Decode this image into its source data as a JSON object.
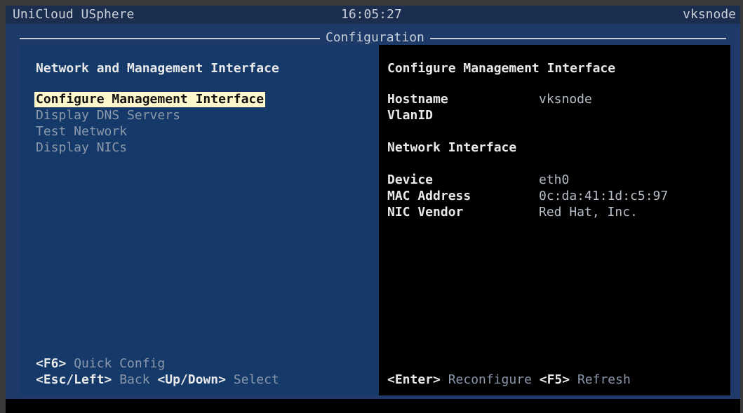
{
  "header": {
    "brand": "UniCloud USphere",
    "time": "16:05:27",
    "hostname": "vksnode"
  },
  "frame_title": "Configuration",
  "left_panel": {
    "heading": "Network and Management Interface",
    "menu": [
      {
        "label": "Configure Management Interface",
        "selected": true
      },
      {
        "label": "Display DNS Servers",
        "selected": false
      },
      {
        "label": "Test Network",
        "selected": false
      },
      {
        "label": "Display NICs",
        "selected": false
      }
    ],
    "footer": {
      "line1": {
        "key": "<F6>",
        "text": " Quick Config"
      },
      "line2": [
        {
          "key": "<Esc/Left>",
          "text": " Back "
        },
        {
          "key": "<Up/Down>",
          "text": " Select"
        }
      ]
    }
  },
  "right_panel": {
    "heading": "Configure Management Interface",
    "fields": [
      {
        "label": "Hostname",
        "value": "vksnode"
      },
      {
        "label": "VlanID",
        "value": ""
      }
    ],
    "section2_heading": "Network Interface",
    "nic_fields": [
      {
        "label": "Device",
        "value": "eth0"
      },
      {
        "label": "MAC Address",
        "value": "0c:da:41:1d:c5:97"
      },
      {
        "label": "NIC Vendor",
        "value": "Red Hat, Inc."
      }
    ],
    "footer": [
      {
        "key": "<Enter>",
        "text": " Reconfigure "
      },
      {
        "key": "<F5>",
        "text": " Refresh"
      }
    ]
  },
  "colors": {
    "frame_bg": "#1e3a68",
    "left_panel_bg": "#153a6a",
    "right_panel_bg": "#000000",
    "highlight_bg": "#fff7cc"
  }
}
